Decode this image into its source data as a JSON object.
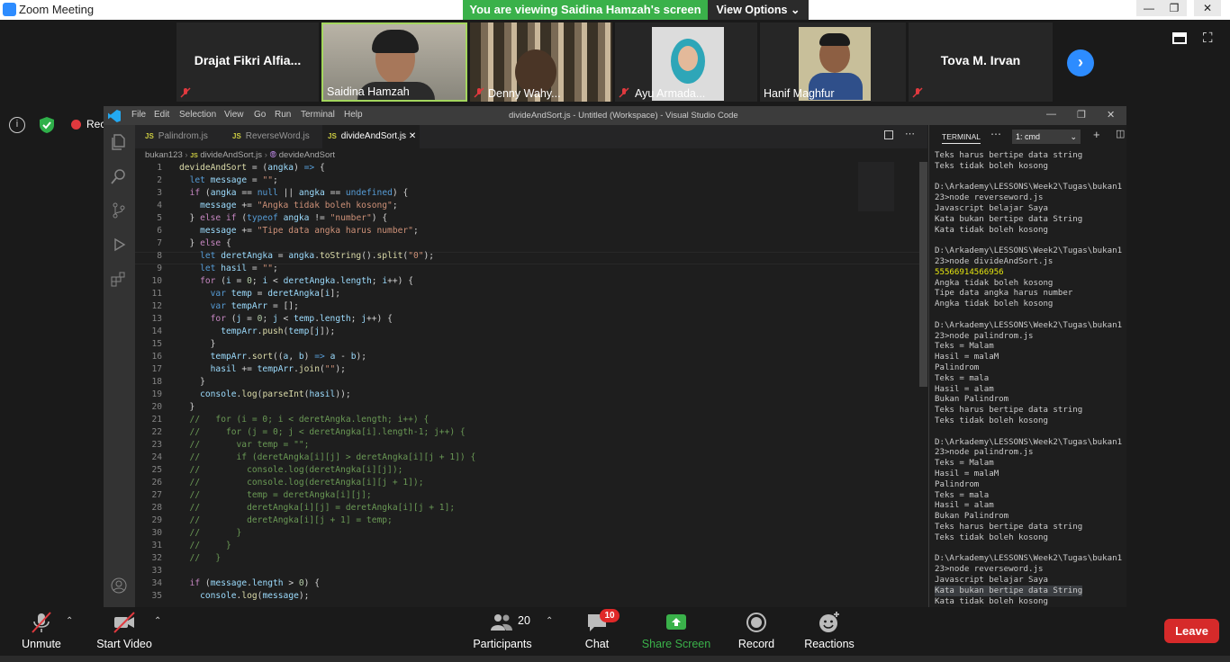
{
  "zoom": {
    "app_title": "Zoom Meeting",
    "banner": "You are viewing Saidina Hamzah's screen",
    "view_options": "View Options"
  },
  "participants": [
    {
      "name": "Drajat  Fikri  Alfia...",
      "video": false,
      "muted": true
    },
    {
      "name": "Saidina Hamzah",
      "video": true,
      "muted": false,
      "active_speaker": true
    },
    {
      "name": "Denny Wahy...",
      "video": true,
      "muted": true
    },
    {
      "name": "Ayu Armada...",
      "video": true,
      "muted": true
    },
    {
      "name": "Hanif Maghfur",
      "video": true,
      "muted": false
    },
    {
      "name": "Tova M. Irvan",
      "video": false,
      "muted": true
    }
  ],
  "recording_label": "Recording",
  "vscode": {
    "menu": [
      "File",
      "Edit",
      "Selection",
      "View",
      "Go",
      "Run",
      "Terminal",
      "Help"
    ],
    "title": "divideAndSort.js - Untitled (Workspace) - Visual Studio Code",
    "tabs": [
      {
        "label": "Palindrom.js",
        "active": false
      },
      {
        "label": "ReverseWord.js",
        "active": false
      },
      {
        "label": "divideAndSort.js",
        "active": true
      }
    ],
    "breadcrumb": {
      "folder": "bukan123",
      "file": "divideAndSort.js",
      "symbol": "devideAndSort"
    },
    "terminal": {
      "tab": "TERMINAL",
      "shell": "1: cmd",
      "lines": [
        "Teks harus bertipe data string",
        "Teks tidak boleh kosong",
        "",
        "D:\\Arkademy\\LESSONS\\Week2\\Tugas\\bukan1",
        "23>node reverseword.js",
        "Javascript belajar Saya",
        "Kata bukan bertipe data String",
        "Kata tidak boleh kosong",
        "",
        "D:\\Arkademy\\LESSONS\\Week2\\Tugas\\bukan1",
        "23>node divideAndSort.js",
        "55566914566956",
        "Angka tidak boleh kosong",
        "Tipe data angka harus number",
        "Angka tidak boleh kosong",
        "",
        "D:\\Arkademy\\LESSONS\\Week2\\Tugas\\bukan1",
        "23>node palindrom.js",
        "Teks = Malam",
        "Hasil = malaM",
        "Palindrom",
        "Teks = mala",
        "Hasil = alam",
        "Bukan Palindrom",
        "Teks harus bertipe data string",
        "Teks tidak boleh kosong",
        "",
        "D:\\Arkademy\\LESSONS\\Week2\\Tugas\\bukan1",
        "23>node palindrom.js",
        "Teks = Malam",
        "Hasil = malaM",
        "Palindrom",
        "Teks = mala",
        "Hasil = alam",
        "Bukan Palindrom",
        "Teks harus bertipe data string",
        "Teks tidak boleh kosong",
        "",
        "D:\\Arkademy\\LESSONS\\Week2\\Tugas\\bukan1",
        "23>node reverseword.js",
        "Javascript belajar Saya",
        "Kata bukan bertipe data String",
        "Kata tidak boleh kosong"
      ]
    }
  },
  "code_lines": [
    [
      {
        "t": "devideAndSort",
        "c": "fn"
      },
      {
        "t": " = ("
      },
      {
        "t": "angka",
        "c": "vr"
      },
      {
        "t": ") "
      },
      {
        "t": "=>",
        "c": "kw"
      },
      {
        "t": " {"
      }
    ],
    [
      {
        "t": "  "
      },
      {
        "t": "let",
        "c": "kw"
      },
      {
        "t": " "
      },
      {
        "t": "message",
        "c": "vr"
      },
      {
        "t": " = "
      },
      {
        "t": "\"\"",
        "c": "str"
      },
      {
        "t": ";"
      }
    ],
    [
      {
        "t": "  "
      },
      {
        "t": "if",
        "c": "ctl"
      },
      {
        "t": " ("
      },
      {
        "t": "angka",
        "c": "vr"
      },
      {
        "t": " == "
      },
      {
        "t": "null",
        "c": "kw"
      },
      {
        "t": " || "
      },
      {
        "t": "angka",
        "c": "vr"
      },
      {
        "t": " == "
      },
      {
        "t": "undefined",
        "c": "kw"
      },
      {
        "t": ") {"
      }
    ],
    [
      {
        "t": "    "
      },
      {
        "t": "message",
        "c": "vr"
      },
      {
        "t": " += "
      },
      {
        "t": "\"Angka tidak boleh kosong\"",
        "c": "str"
      },
      {
        "t": ";"
      }
    ],
    [
      {
        "t": "  } "
      },
      {
        "t": "else",
        "c": "ctl"
      },
      {
        "t": " "
      },
      {
        "t": "if",
        "c": "ctl"
      },
      {
        "t": " ("
      },
      {
        "t": "typeof",
        "c": "kw"
      },
      {
        "t": " "
      },
      {
        "t": "angka",
        "c": "vr"
      },
      {
        "t": " != "
      },
      {
        "t": "\"number\"",
        "c": "str"
      },
      {
        "t": ") {"
      }
    ],
    [
      {
        "t": "    "
      },
      {
        "t": "message",
        "c": "vr"
      },
      {
        "t": " += "
      },
      {
        "t": "\"Tipe data angka harus number\"",
        "c": "str"
      },
      {
        "t": ";"
      }
    ],
    [
      {
        "t": "  } "
      },
      {
        "t": "else",
        "c": "ctl"
      },
      {
        "t": " {"
      }
    ],
    [
      {
        "t": "    "
      },
      {
        "t": "let",
        "c": "kw"
      },
      {
        "t": " "
      },
      {
        "t": "deretAngka",
        "c": "vr"
      },
      {
        "t": " = "
      },
      {
        "t": "angka",
        "c": "vr"
      },
      {
        "t": "."
      },
      {
        "t": "toString",
        "c": "fn"
      },
      {
        "t": "()."
      },
      {
        "t": "split",
        "c": "fn"
      },
      {
        "t": "("
      },
      {
        "t": "\"0\"",
        "c": "str"
      },
      {
        "t": ");"
      }
    ],
    [
      {
        "t": "    "
      },
      {
        "t": "let",
        "c": "kw"
      },
      {
        "t": " "
      },
      {
        "t": "hasil",
        "c": "vr"
      },
      {
        "t": " = "
      },
      {
        "t": "\"\"",
        "c": "str"
      },
      {
        "t": ";"
      }
    ],
    [
      {
        "t": "    "
      },
      {
        "t": "for",
        "c": "ctl"
      },
      {
        "t": " ("
      },
      {
        "t": "i",
        "c": "vr"
      },
      {
        "t": " = "
      },
      {
        "t": "0",
        "c": "num"
      },
      {
        "t": "; "
      },
      {
        "t": "i",
        "c": "vr"
      },
      {
        "t": " < "
      },
      {
        "t": "deretAngka",
        "c": "vr"
      },
      {
        "t": "."
      },
      {
        "t": "length",
        "c": "vr"
      },
      {
        "t": "; "
      },
      {
        "t": "i",
        "c": "vr"
      },
      {
        "t": "++) {"
      }
    ],
    [
      {
        "t": "      "
      },
      {
        "t": "var",
        "c": "kw"
      },
      {
        "t": " "
      },
      {
        "t": "temp",
        "c": "vr"
      },
      {
        "t": " = "
      },
      {
        "t": "deretAngka",
        "c": "vr"
      },
      {
        "t": "["
      },
      {
        "t": "i",
        "c": "vr"
      },
      {
        "t": "];"
      }
    ],
    [
      {
        "t": "      "
      },
      {
        "t": "var",
        "c": "kw"
      },
      {
        "t": " "
      },
      {
        "t": "tempArr",
        "c": "vr"
      },
      {
        "t": " = [];"
      }
    ],
    [
      {
        "t": "      "
      },
      {
        "t": "for",
        "c": "ctl"
      },
      {
        "t": " ("
      },
      {
        "t": "j",
        "c": "vr"
      },
      {
        "t": " = "
      },
      {
        "t": "0",
        "c": "num"
      },
      {
        "t": "; "
      },
      {
        "t": "j",
        "c": "vr"
      },
      {
        "t": " < "
      },
      {
        "t": "temp",
        "c": "vr"
      },
      {
        "t": "."
      },
      {
        "t": "length",
        "c": "vr"
      },
      {
        "t": "; "
      },
      {
        "t": "j",
        "c": "vr"
      },
      {
        "t": "++) {"
      }
    ],
    [
      {
        "t": "        "
      },
      {
        "t": "tempArr",
        "c": "vr"
      },
      {
        "t": "."
      },
      {
        "t": "push",
        "c": "fn"
      },
      {
        "t": "("
      },
      {
        "t": "temp",
        "c": "vr"
      },
      {
        "t": "["
      },
      {
        "t": "j",
        "c": "vr"
      },
      {
        "t": "]);"
      }
    ],
    [
      {
        "t": "      }"
      }
    ],
    [
      {
        "t": "      "
      },
      {
        "t": "tempArr",
        "c": "vr"
      },
      {
        "t": "."
      },
      {
        "t": "sort",
        "c": "fn"
      },
      {
        "t": "(("
      },
      {
        "t": "a",
        "c": "vr"
      },
      {
        "t": ", "
      },
      {
        "t": "b",
        "c": "vr"
      },
      {
        "t": ") "
      },
      {
        "t": "=>",
        "c": "kw"
      },
      {
        "t": " "
      },
      {
        "t": "a",
        "c": "vr"
      },
      {
        "t": " - "
      },
      {
        "t": "b",
        "c": "vr"
      },
      {
        "t": ");"
      }
    ],
    [
      {
        "t": "      "
      },
      {
        "t": "hasil",
        "c": "vr"
      },
      {
        "t": " += "
      },
      {
        "t": "tempArr",
        "c": "vr"
      },
      {
        "t": "."
      },
      {
        "t": "join",
        "c": "fn"
      },
      {
        "t": "("
      },
      {
        "t": "\"\"",
        "c": "str"
      },
      {
        "t": ");"
      }
    ],
    [
      {
        "t": "    }"
      }
    ],
    [
      {
        "t": "    "
      },
      {
        "t": "console",
        "c": "vr"
      },
      {
        "t": "."
      },
      {
        "t": "log",
        "c": "fn"
      },
      {
        "t": "("
      },
      {
        "t": "parseInt",
        "c": "fn"
      },
      {
        "t": "("
      },
      {
        "t": "hasil",
        "c": "vr"
      },
      {
        "t": "));"
      }
    ],
    [
      {
        "t": "  }"
      }
    ],
    [
      {
        "t": "  //   for (i = 0; i < deretAngka.length; i++) {",
        "c": "com"
      }
    ],
    [
      {
        "t": "  //     for (j = 0; j < deretAngka[i].length-1; j++) {",
        "c": "com"
      }
    ],
    [
      {
        "t": "  //       var temp = \"\";",
        "c": "com"
      }
    ],
    [
      {
        "t": "  //       if (deretAngka[i][j] > deretAngka[i][j + 1]) {",
        "c": "com"
      }
    ],
    [
      {
        "t": "  //         console.log(deretAngka[i][j]);",
        "c": "com"
      }
    ],
    [
      {
        "t": "  //         console.log(deretAngka[i][j + 1]);",
        "c": "com"
      }
    ],
    [
      {
        "t": "  //         temp = deretAngka[i][j];",
        "c": "com"
      }
    ],
    [
      {
        "t": "  //         deretAngka[i][j] = deretAngka[i][j + 1];",
        "c": "com"
      }
    ],
    [
      {
        "t": "  //         deretAngka[i][j + 1] = temp;",
        "c": "com"
      }
    ],
    [
      {
        "t": "  //       }",
        "c": "com"
      }
    ],
    [
      {
        "t": "  //     }",
        "c": "com"
      }
    ],
    [
      {
        "t": "  //   }",
        "c": "com"
      }
    ],
    [
      {
        "t": ""
      }
    ],
    [
      {
        "t": "  "
      },
      {
        "t": "if",
        "c": "ctl"
      },
      {
        "t": " ("
      },
      {
        "t": "message",
        "c": "vr"
      },
      {
        "t": "."
      },
      {
        "t": "length",
        "c": "vr"
      },
      {
        "t": " > "
      },
      {
        "t": "0",
        "c": "num"
      },
      {
        "t": ") {"
      }
    ],
    [
      {
        "t": "    "
      },
      {
        "t": "console",
        "c": "vr"
      },
      {
        "t": "."
      },
      {
        "t": "log",
        "c": "fn"
      },
      {
        "t": "("
      },
      {
        "t": "message",
        "c": "vr"
      },
      {
        "t": ");"
      }
    ]
  ],
  "toolbar": {
    "unmute": "Unmute",
    "start_video": "Start Video",
    "participants_count": "20",
    "participants": "Participants",
    "chat": "Chat",
    "chat_badge": "10",
    "share_screen": "Share Screen",
    "record": "Record",
    "reactions": "Reactions",
    "leave": "Leave"
  },
  "colors": {
    "zoom_green": "#3ab14a",
    "zoom_blue": "#2d8cff",
    "leave_red": "#d62a2a",
    "vscode_bg": "#1e1e1e"
  }
}
